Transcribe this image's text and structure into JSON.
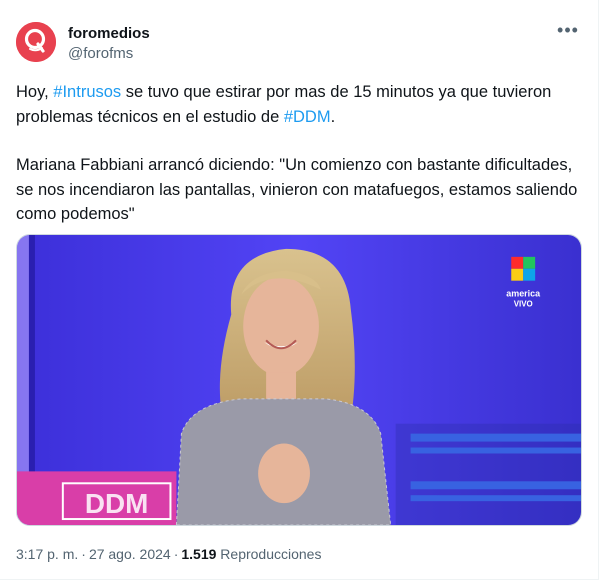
{
  "author": {
    "display_name": "foromedios",
    "handle": "@forofms",
    "avatar_color": "#e63946"
  },
  "tweet": {
    "line1_a": "Hoy, ",
    "hashtag1": "#Intrusos",
    "line1_b": " se tuvo que estirar por mas de 15 minutos ya que tuvieron problemas técnicos en el estudio de ",
    "hashtag2": "#DDM",
    "line1_c": ".",
    "paragraph2": "Mariana Fabbiani arrancó diciendo: \"Un comienzo con bastante dificultades, se nos incendiaron las pantallas, vinieron con matafuegos, estamos saliendo como podemos\""
  },
  "media": {
    "channel_name": "america",
    "channel_status": "VIVO",
    "floor_logo": "DDM"
  },
  "meta": {
    "time": "3:17 p. m.",
    "separator": "·",
    "date": "27 ago. 2024",
    "views_count": "1.519",
    "views_label": "Reproducciones"
  },
  "colors": {
    "hashtag": "#1d9bf0",
    "secondary_text": "#536471",
    "studio_blue": "#4a3df0"
  },
  "icons": {
    "more": "more-icon",
    "avatar": "foromedios-logo-icon"
  }
}
